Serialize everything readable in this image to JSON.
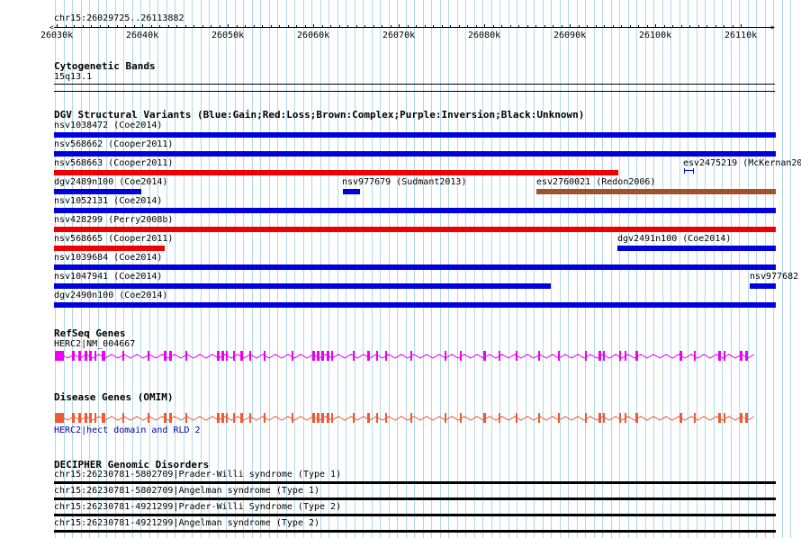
{
  "colors": {
    "gain": "#0000dd",
    "loss": "#ee0000",
    "complex": "#a0522d",
    "refseq": "#ee00ee",
    "omim": "#f05a32",
    "omim_label": "#0000aa",
    "grid": "#b0d8e8"
  },
  "ruler": {
    "locus": "chr15:26029725..26113882",
    "ticks": [
      "26030k",
      "26040k",
      "26050k",
      "26060k",
      "26070k",
      "26080k",
      "26090k",
      "26100k",
      "26110k"
    ]
  },
  "cytobands": {
    "title": "Cytogenetic Bands",
    "band": "15q13.1"
  },
  "dgv": {
    "title": "DGV Structural Variants (Blue:Gain;Red:Loss;Brown:Complex;Purple:Inversion;Black:Unknown)",
    "features": [
      {
        "label": "nsv1038472 (Coe2014)",
        "type": "gain"
      },
      {
        "label": "nsv568662 (Cooper2011)",
        "type": "gain"
      },
      {
        "label": "nsv568663 (Cooper2011)",
        "type": "loss"
      },
      {
        "label": "esv2475219 (McKernan20",
        "type": "gain"
      },
      {
        "label": "dgv2489n100 (Coe2014)",
        "type": "gain"
      },
      {
        "label": "nsv977679 (Sudmant2013)",
        "type": "gain"
      },
      {
        "label": "esv2760021 (Redon2006)",
        "type": "complex"
      },
      {
        "label": "nsv1052131 (Coe2014)",
        "type": "gain"
      },
      {
        "label": "nsv428299 (Perry2008b)",
        "type": "loss"
      },
      {
        "label": "nsv568665 (Cooper2011)",
        "type": "loss"
      },
      {
        "label": "dgv2491n100 (Coe2014)",
        "type": "gain"
      },
      {
        "label": "nsv1039684 (Coe2014)",
        "type": "gain"
      },
      {
        "label": "nsv1047941 (Coe2014)",
        "type": "gain"
      },
      {
        "label": "nsv977682",
        "type": "gain"
      },
      {
        "label": "dgv2490n100 (Coe2014)",
        "type": "gain"
      }
    ]
  },
  "refseq": {
    "title": "RefSeq Genes",
    "gene_label": "HERC2|NM_004667"
  },
  "omim": {
    "title": "Disease Genes (OMIM)",
    "gene_label": "HERC2|hect domain and RLD 2"
  },
  "decipher": {
    "title": "DECIPHER Genomic Disorders",
    "features": [
      {
        "label": "chr15:26230781-5802709|Prader-Willi syndrome (Type 1)"
      },
      {
        "label": "chr15:26230781-5802709|Angelman syndrome (Type 1)"
      },
      {
        "label": "chr15:26230781-4921299|Prader-Willi Syndrome (Type 2)"
      },
      {
        "label": "chr15:26230781-4921299|Angelman syndrome (Type 2)"
      }
    ]
  }
}
